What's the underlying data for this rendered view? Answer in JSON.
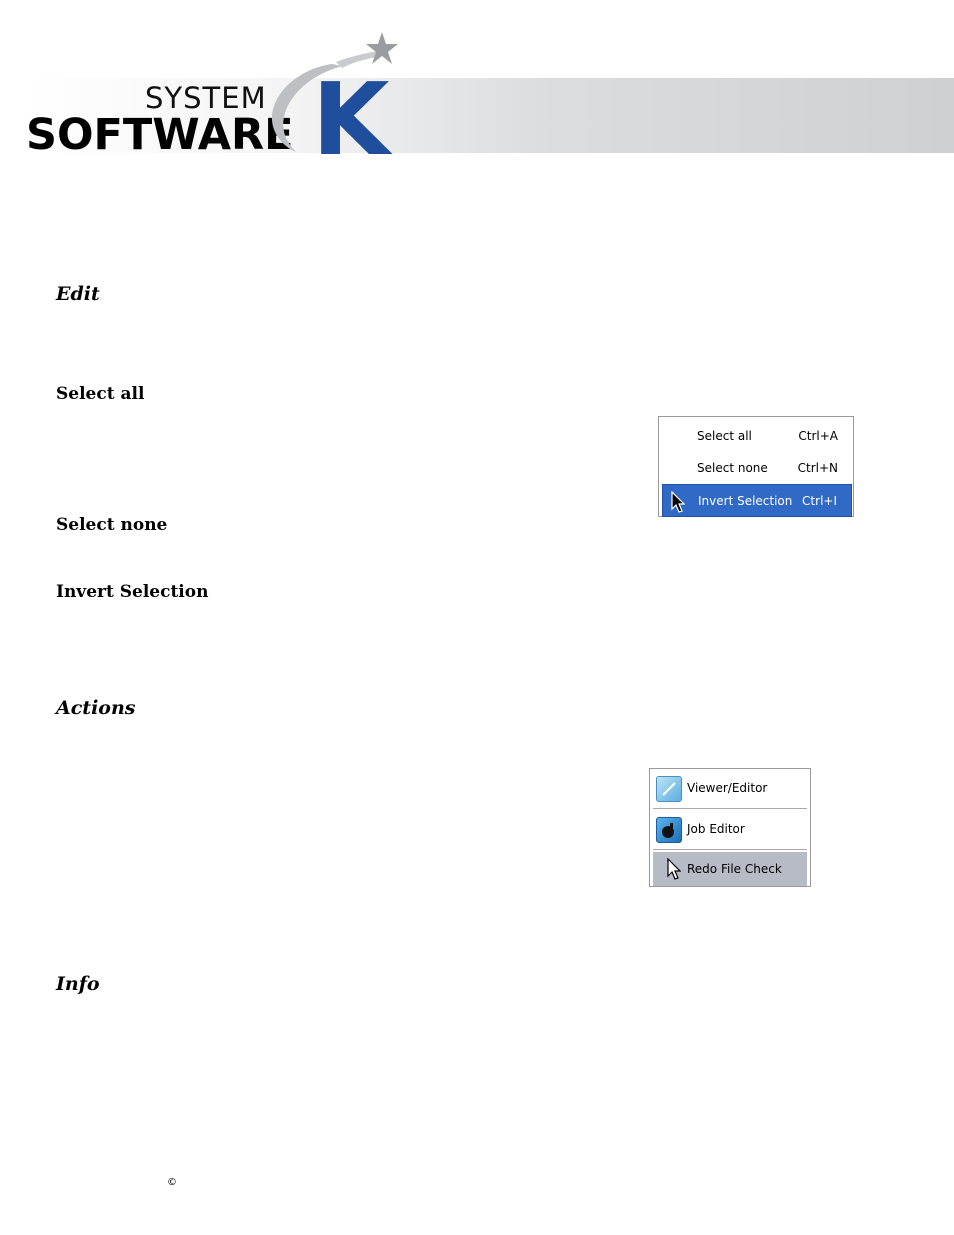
{
  "header": {
    "logo_line1": "SYSTEM",
    "logo_line2": "SOFTWARE",
    "logo_letter": "K",
    "brand_color": "#1f4e9c"
  },
  "sections": {
    "edit_heading": "Edit",
    "select_all": "Select all",
    "select_none": "Select none",
    "invert_selection": "Invert Selection",
    "actions_heading": "Actions",
    "info_heading": "Info"
  },
  "edit_menu": {
    "items": [
      {
        "label": "Select all",
        "shortcut": "Ctrl+A"
      },
      {
        "label": "Select none",
        "shortcut": "Ctrl+N"
      },
      {
        "label": "Invert Selection",
        "shortcut": "Ctrl+I"
      }
    ],
    "highlight_color": "#3169c6"
  },
  "actions_menu": {
    "items": [
      {
        "label": "Viewer/Editor",
        "icon": "viewer-editor-icon"
      },
      {
        "label": "Job Editor",
        "icon": "job-editor-icon"
      },
      {
        "label": "Redo File Check",
        "icon": "cursor-icon"
      }
    ],
    "highlight_color": "#b7bbc6"
  },
  "footer": {
    "copyright_symbol": "©"
  }
}
